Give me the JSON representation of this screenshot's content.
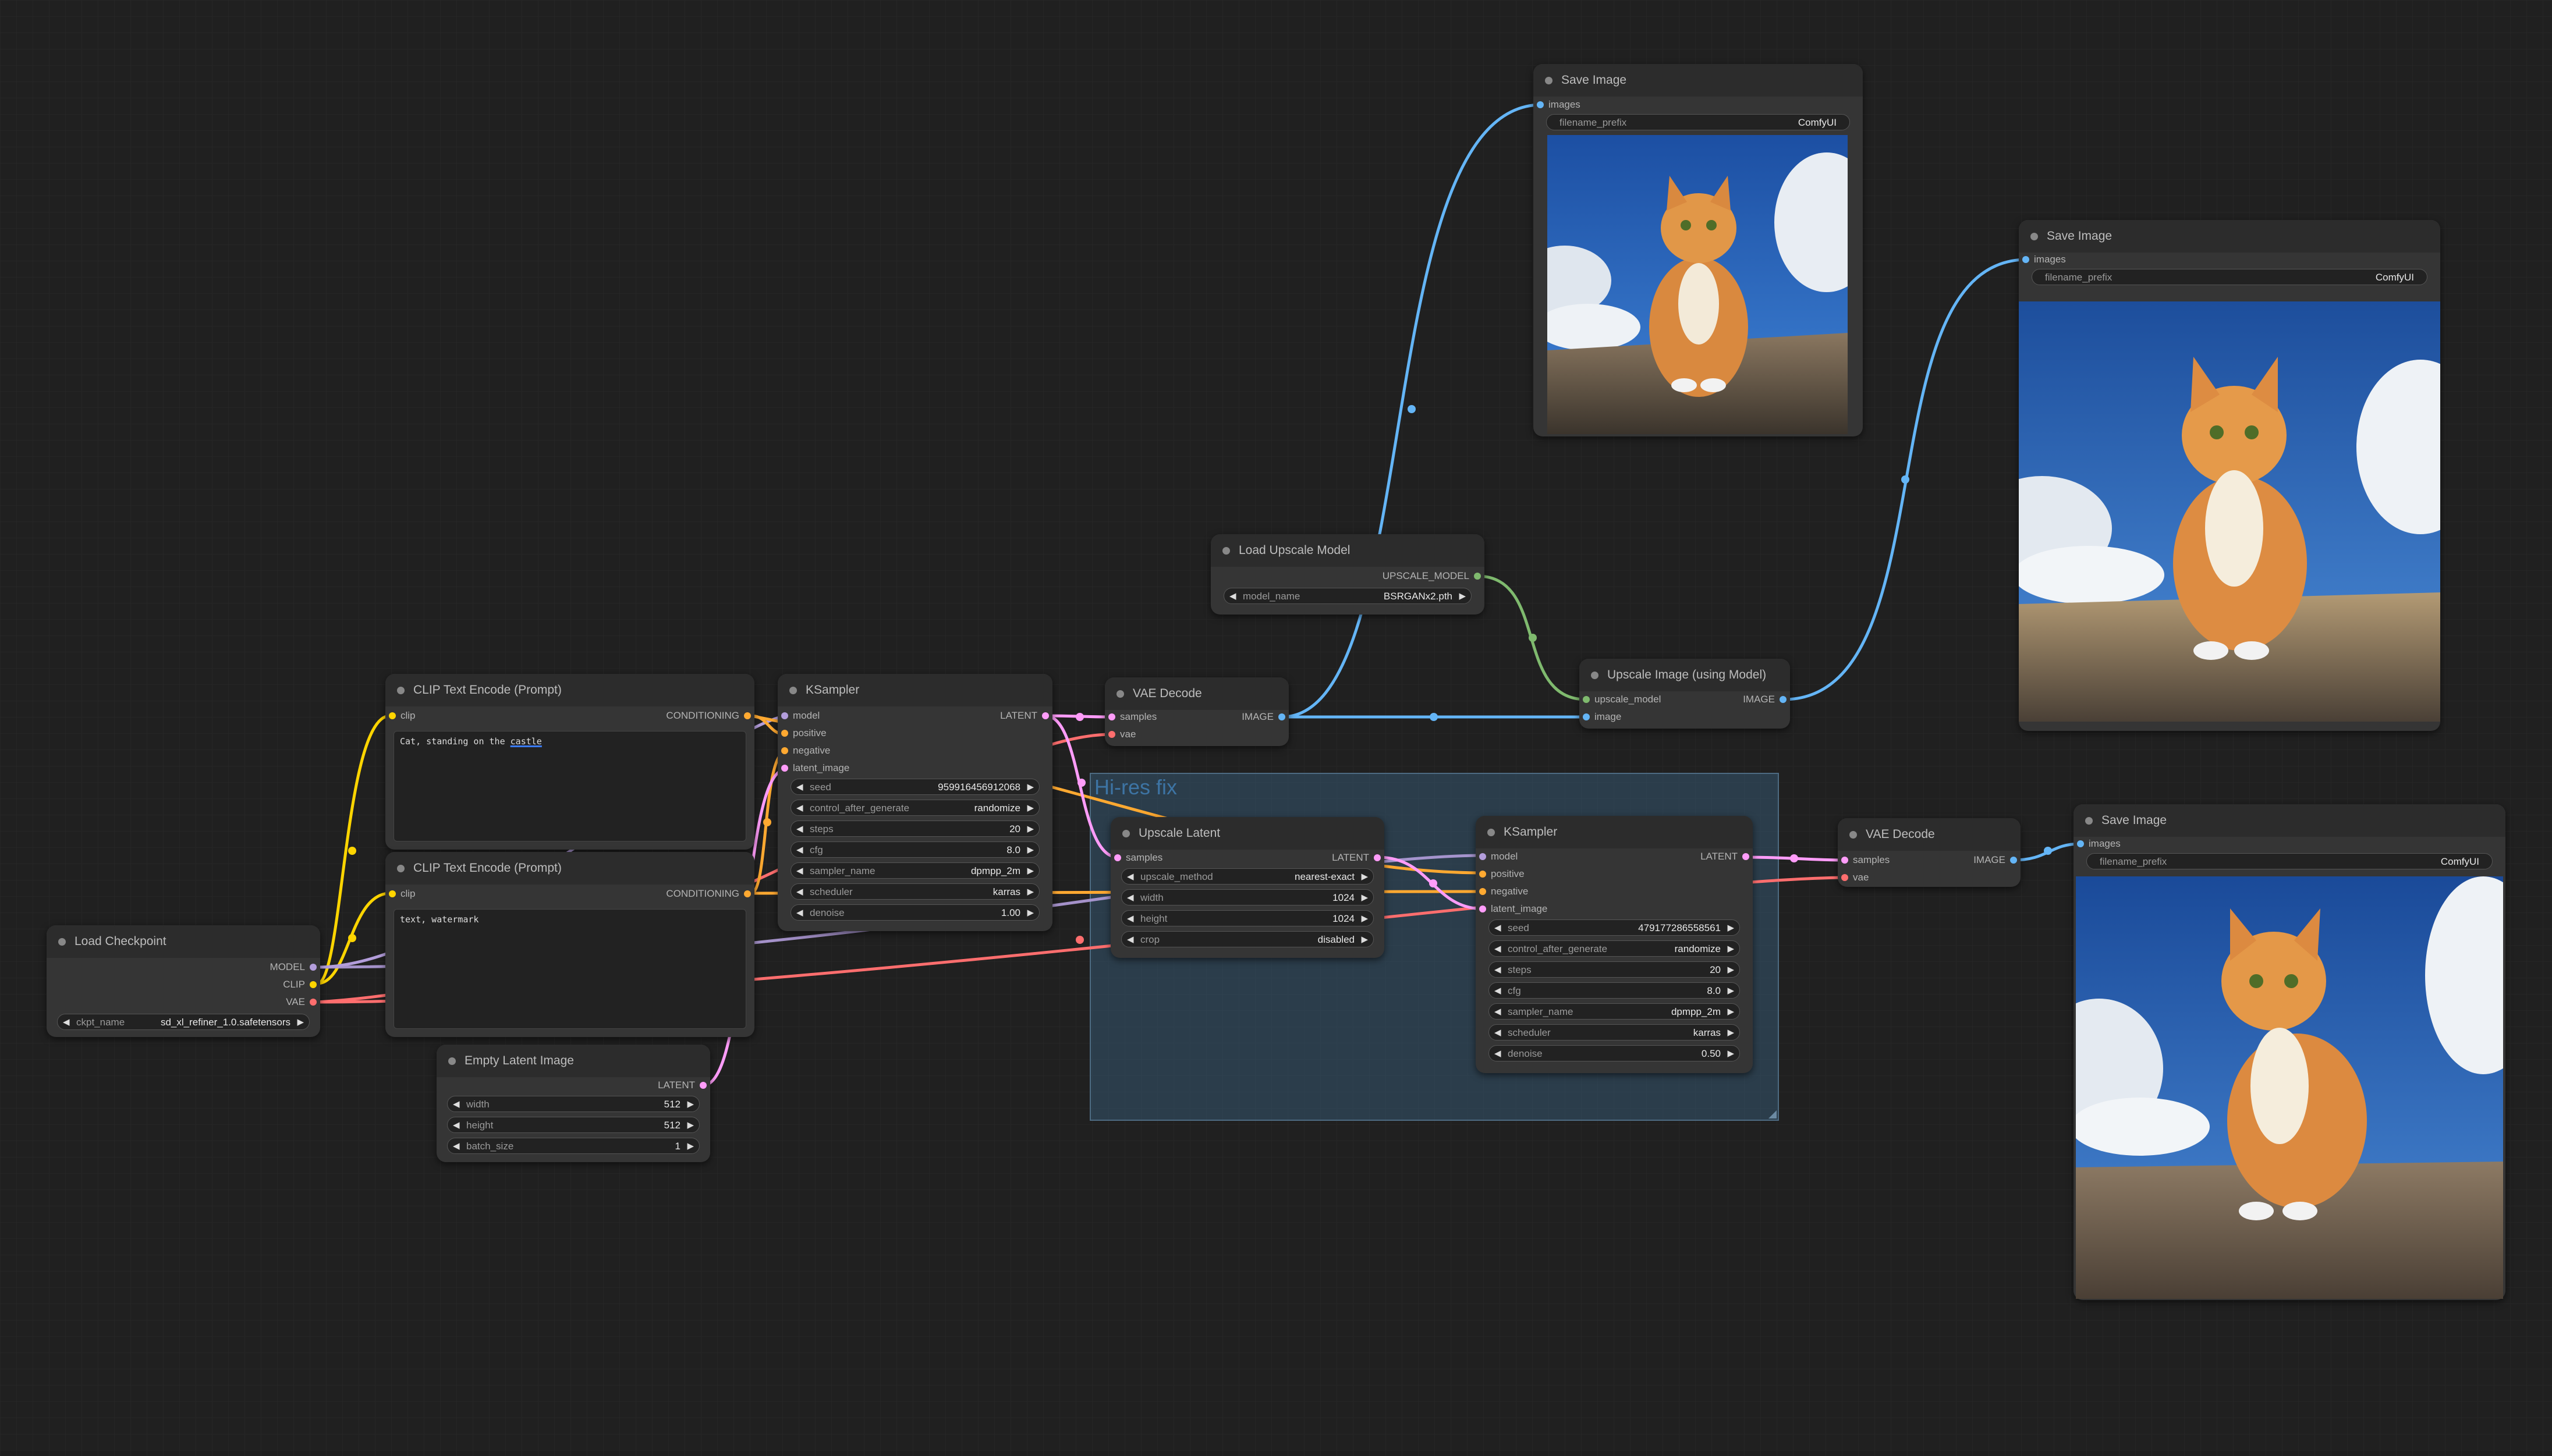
{
  "colors": {
    "model": "#b39ddb",
    "clip": "#ffd500",
    "vae": "#ff6e6e",
    "conditioning": "#ffa931",
    "latent": "#ff9cf9",
    "image": "#64b5f6",
    "upscale_model": "#7fba6e"
  },
  "group": {
    "title": "Hi-res fix"
  },
  "load_checkpoint": {
    "title": "Load Checkpoint",
    "outputs": {
      "model": "MODEL",
      "clip": "CLIP",
      "vae": "VAE"
    },
    "ckpt_label": "ckpt_name",
    "ckpt_value": "sd_xl_refiner_1.0.safetensors"
  },
  "clip_pos": {
    "title": "CLIP Text Encode (Prompt)",
    "input": "clip",
    "output": "CONDITIONING",
    "text_before": "Cat, standing on the ",
    "text_word": "castle"
  },
  "clip_neg": {
    "title": "CLIP Text Encode (Prompt)",
    "input": "clip",
    "output": "CONDITIONING",
    "text": "text, watermark"
  },
  "empty_latent": {
    "title": "Empty Latent Image",
    "output": "LATENT",
    "width_label": "width",
    "width": "512",
    "height_label": "height",
    "height": "512",
    "batch_label": "batch_size",
    "batch": "1"
  },
  "ksampler1": {
    "title": "KSampler",
    "inputs": {
      "model": "model",
      "positive": "positive",
      "negative": "negative",
      "latent": "latent_image"
    },
    "output": "LATENT",
    "widgets": [
      {
        "label": "seed",
        "value": "959916456912068"
      },
      {
        "label": "control_after_generate",
        "value": "randomize"
      },
      {
        "label": "steps",
        "value": "20"
      },
      {
        "label": "cfg",
        "value": "8.0"
      },
      {
        "label": "sampler_name",
        "value": "dpmpp_2m"
      },
      {
        "label": "scheduler",
        "value": "karras"
      },
      {
        "label": "denoise",
        "value": "1.00"
      }
    ]
  },
  "vae_decode1": {
    "title": "VAE Decode",
    "inputs": {
      "samples": "samples",
      "vae": "vae"
    },
    "output": "IMAGE"
  },
  "load_upscale": {
    "title": "Load Upscale Model",
    "output": "UPSCALE_MODEL",
    "model_label": "model_name",
    "model_value": "BSRGANx2.pth"
  },
  "upscale_image": {
    "title": "Upscale Image (using Model)",
    "inputs": {
      "upscale_model": "upscale_model",
      "image": "image"
    },
    "output": "IMAGE"
  },
  "save1": {
    "title": "Save Image",
    "input": "images",
    "prefix_label": "filename_prefix",
    "prefix_value": "ComfyUI"
  },
  "save2": {
    "title": "Save Image",
    "input": "images",
    "prefix_label": "filename_prefix",
    "prefix_value": "ComfyUI"
  },
  "save3": {
    "title": "Save Image",
    "input": "images",
    "prefix_label": "filename_prefix",
    "prefix_value": "ComfyUI"
  },
  "upscale_latent": {
    "title": "Upscale Latent",
    "input": "samples",
    "output": "LATENT",
    "widgets": [
      {
        "label": "upscale_method",
        "value": "nearest-exact"
      },
      {
        "label": "width",
        "value": "1024"
      },
      {
        "label": "height",
        "value": "1024"
      },
      {
        "label": "crop",
        "value": "disabled"
      }
    ]
  },
  "ksampler2": {
    "title": "KSampler",
    "inputs": {
      "model": "model",
      "positive": "positive",
      "negative": "negative",
      "latent": "latent_image"
    },
    "output": "LATENT",
    "widgets": [
      {
        "label": "seed",
        "value": "479177286558561"
      },
      {
        "label": "control_after_generate",
        "value": "randomize"
      },
      {
        "label": "steps",
        "value": "20"
      },
      {
        "label": "cfg",
        "value": "8.0"
      },
      {
        "label": "sampler_name",
        "value": "dpmpp_2m"
      },
      {
        "label": "scheduler",
        "value": "karras"
      },
      {
        "label": "denoise",
        "value": "0.50"
      }
    ]
  },
  "vae_decode2": {
    "title": "VAE Decode",
    "inputs": {
      "samples": "samples",
      "vae": "vae"
    },
    "output": "IMAGE"
  }
}
